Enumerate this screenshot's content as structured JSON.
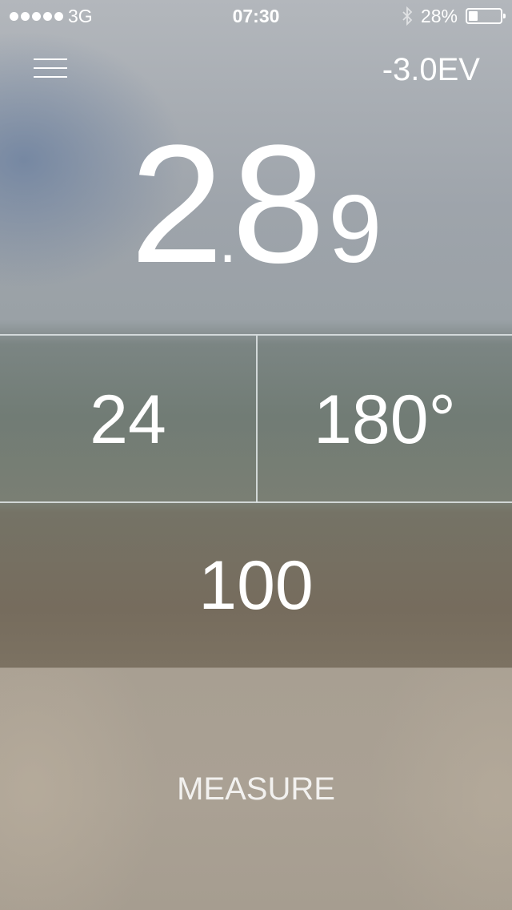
{
  "status_bar": {
    "carrier": "3G",
    "time": "07:30",
    "battery_percent_text": "28%",
    "battery_level": 0.28,
    "icons": [
      "signal-dots-icon",
      "bluetooth-icon",
      "battery-icon"
    ]
  },
  "header": {
    "menu_icon": "hamburger-menu-icon",
    "ev_compensation": "-3.0EV"
  },
  "reading": {
    "aperture_integer": "2",
    "aperture_separator": ".",
    "aperture_decimal": "8",
    "aperture_subscript": "9"
  },
  "settings": {
    "shutter_or_fps": "24",
    "shutter_angle": "180°",
    "iso": "100"
  },
  "actions": {
    "measure_label": "MEASURE"
  },
  "colors": {
    "text": "#ffffff",
    "divider": "#e1e6e8"
  }
}
